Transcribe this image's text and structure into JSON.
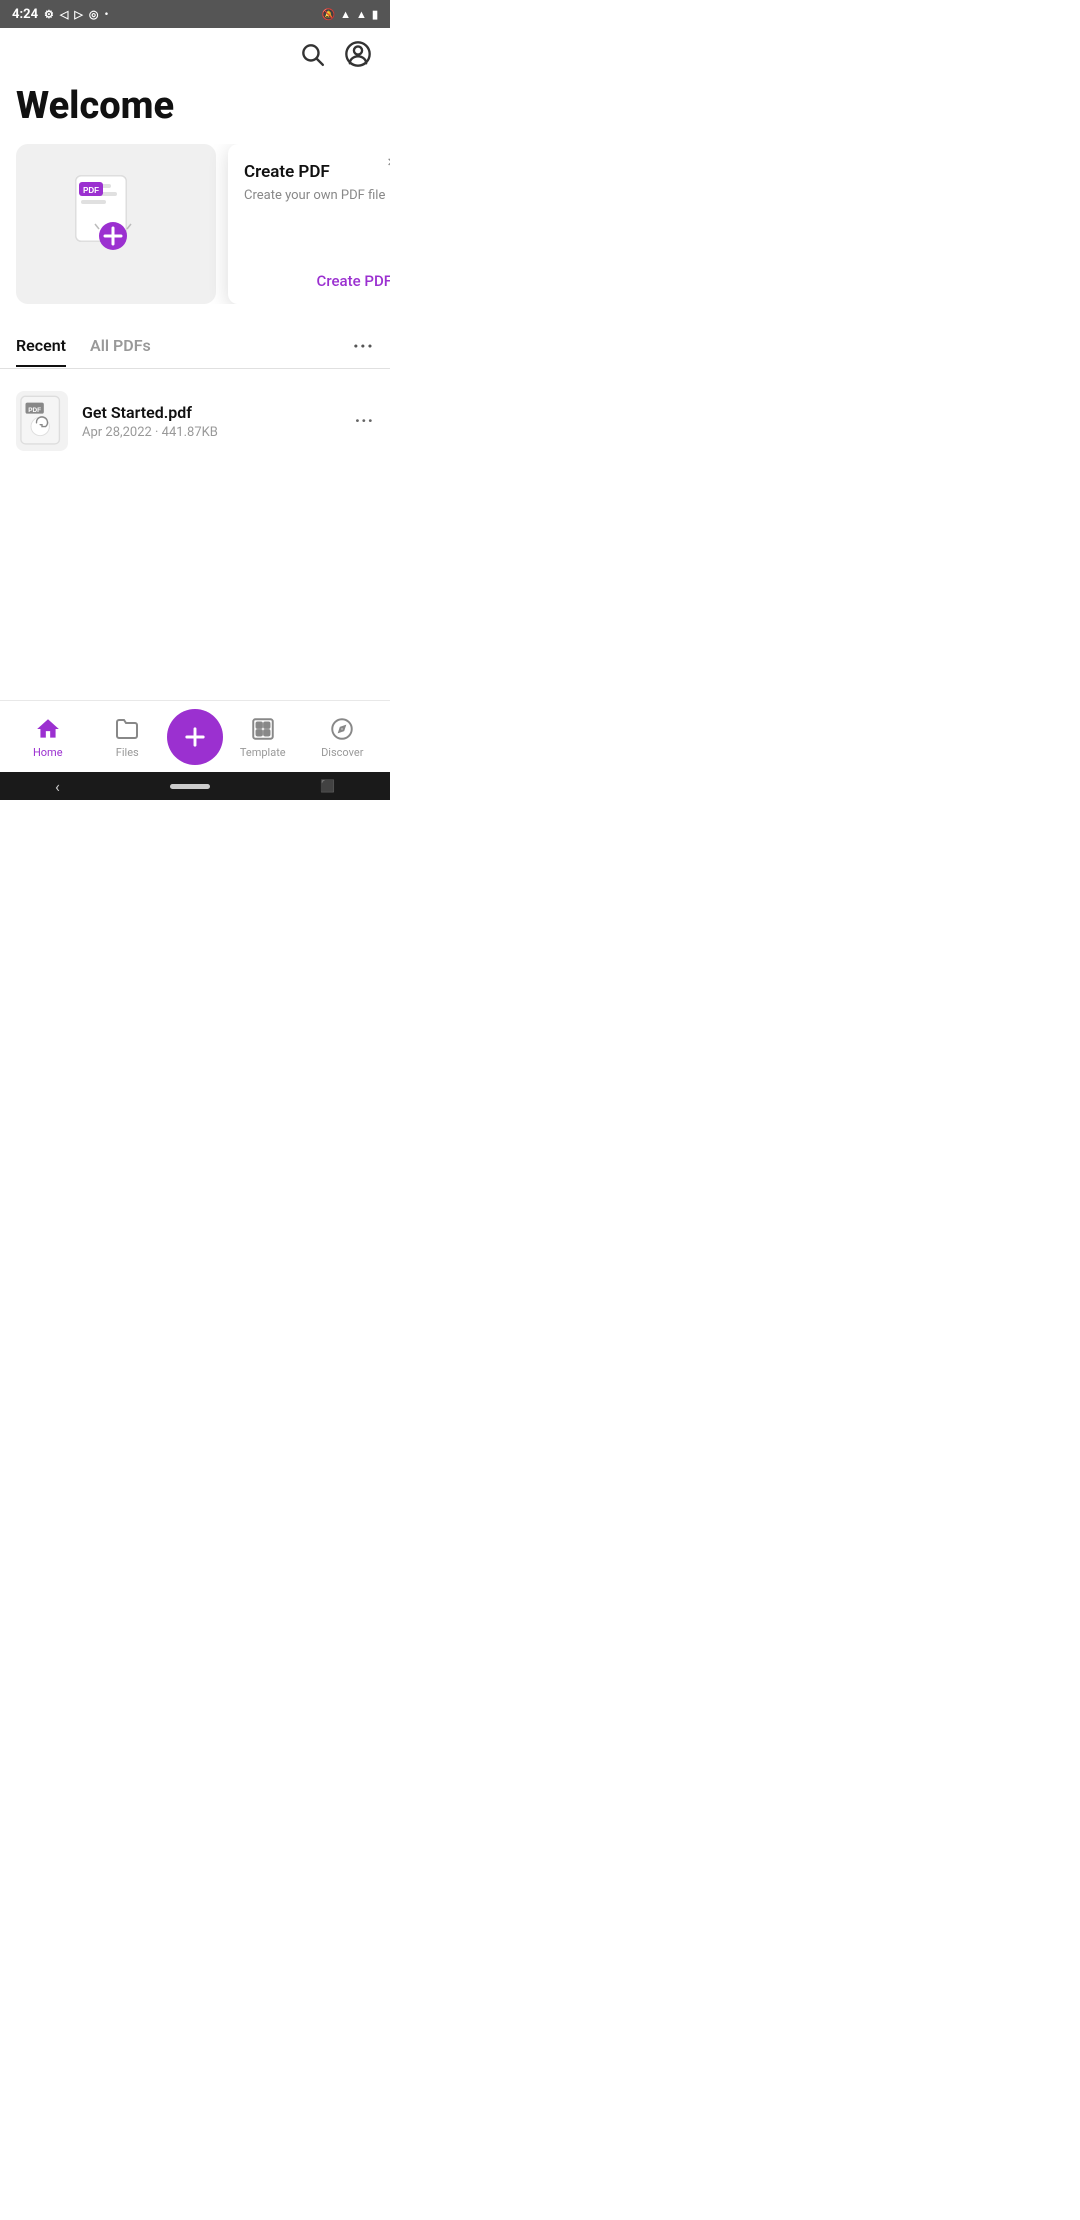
{
  "statusBar": {
    "time": "4:24",
    "icons": [
      "settings",
      "location-off",
      "send",
      "whatsapp",
      "dot"
    ]
  },
  "header": {
    "searchIcon": "search",
    "profileIcon": "account-circle"
  },
  "welcome": {
    "title": "Welcome"
  },
  "tooltip": {
    "title": "Create PDF",
    "description": "Create your own PDF file",
    "actionLabel": "Create PDF",
    "closeIcon": "×"
  },
  "tabs": {
    "items": [
      {
        "label": "Recent",
        "active": true
      },
      {
        "label": "All PDFs",
        "active": false
      }
    ],
    "moreIcon": "···"
  },
  "files": [
    {
      "name": "Get Started.pdf",
      "date": "Apr 28,2022",
      "size": "441.87KB",
      "moreIcon": "···"
    }
  ],
  "bottomNav": {
    "items": [
      {
        "id": "home",
        "label": "Home",
        "active": true
      },
      {
        "id": "files",
        "label": "Files",
        "active": false
      },
      {
        "id": "fab",
        "label": "+",
        "active": false
      },
      {
        "id": "template",
        "label": "Template",
        "active": false
      },
      {
        "id": "discover",
        "label": "Discover",
        "active": false
      }
    ]
  }
}
